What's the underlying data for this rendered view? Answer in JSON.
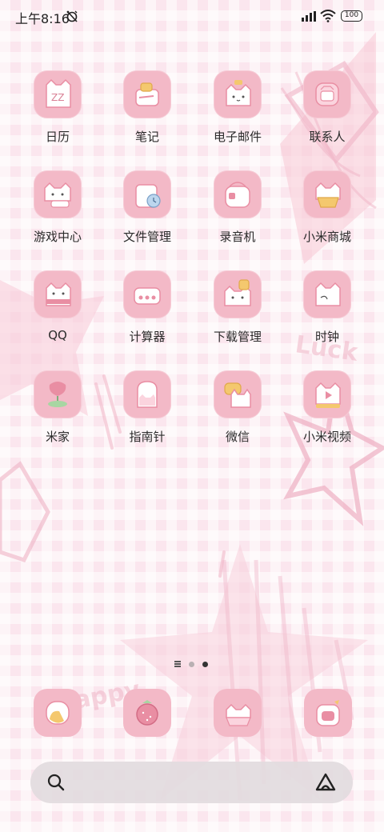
{
  "status_bar": {
    "time": "上午8:16",
    "battery": "100"
  },
  "apps": [
    {
      "label": "日历",
      "icon": "calendar-icon"
    },
    {
      "label": "笔记",
      "icon": "notes-icon"
    },
    {
      "label": "电子邮件",
      "icon": "email-icon"
    },
    {
      "label": "联系人",
      "icon": "contacts-icon"
    },
    {
      "label": "游戏中心",
      "icon": "game-center-icon"
    },
    {
      "label": "文件管理",
      "icon": "file-manager-icon"
    },
    {
      "label": "录音机",
      "icon": "recorder-icon"
    },
    {
      "label": "小米商城",
      "icon": "mi-store-icon"
    },
    {
      "label": "QQ",
      "icon": "qq-icon"
    },
    {
      "label": "计算器",
      "icon": "calculator-icon"
    },
    {
      "label": "下载管理",
      "icon": "downloads-icon"
    },
    {
      "label": "时钟",
      "icon": "clock-icon"
    },
    {
      "label": "米家",
      "icon": "mijia-icon"
    },
    {
      "label": "指南针",
      "icon": "compass-icon"
    },
    {
      "label": "微信",
      "icon": "wechat-icon"
    },
    {
      "label": "小米视频",
      "icon": "mi-video-icon"
    }
  ],
  "dock": [
    {
      "icon": "phone-icon"
    },
    {
      "icon": "browser-icon"
    },
    {
      "icon": "messages-icon"
    },
    {
      "icon": "camera-icon"
    }
  ],
  "pager": {
    "pages": 2,
    "active": 2
  },
  "decor_text": [
    "Luck",
    "Happy"
  ],
  "colors": {
    "background": "#fbe6ee",
    "icon_tile": "#f3b9c7",
    "cat_white": "#ffffff",
    "accent_pink": "#e98ea3",
    "accent_yellow": "#f4c86e"
  }
}
